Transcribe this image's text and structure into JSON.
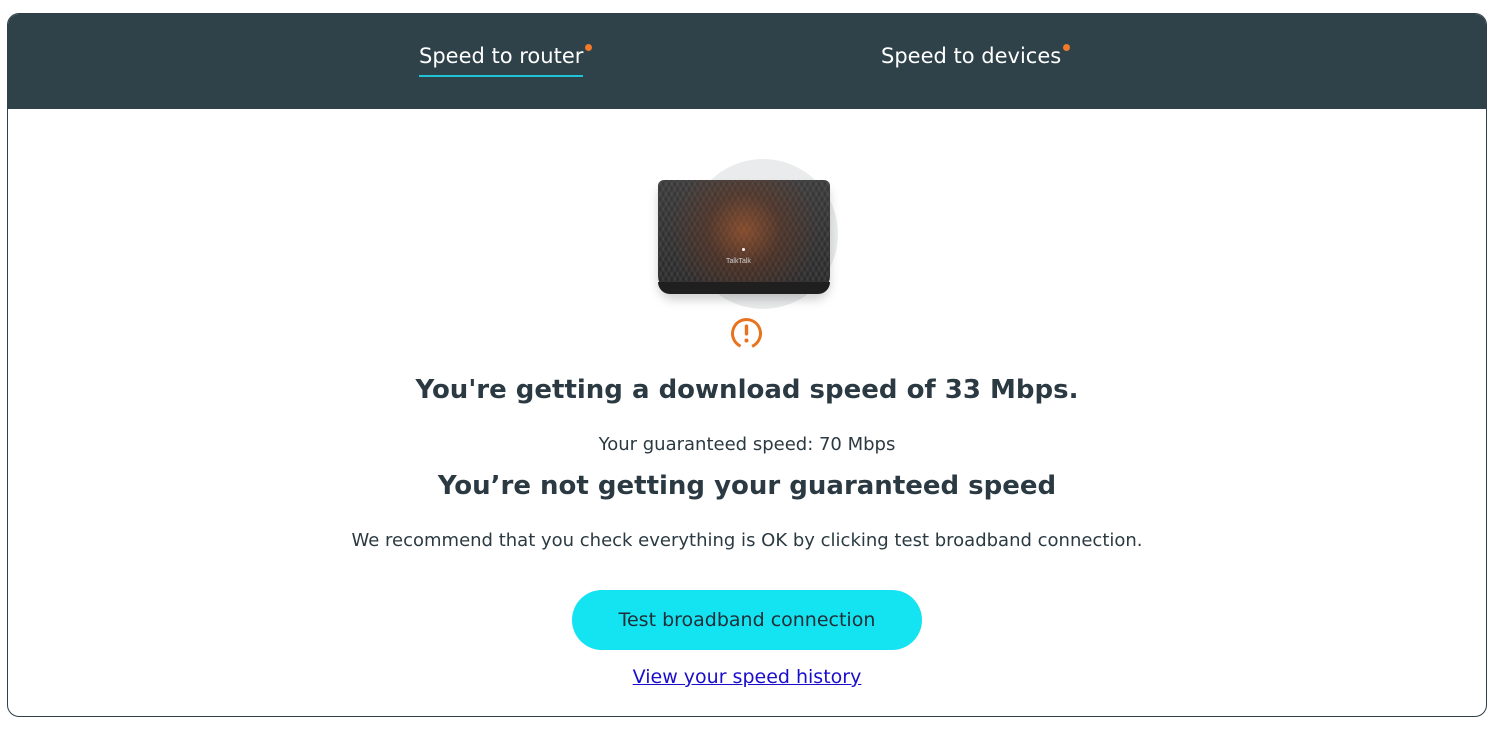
{
  "tabs": {
    "router_label": "Speed to router",
    "devices_label": "Speed to devices",
    "active": "router"
  },
  "router_image": {
    "logo_text": "TalkTalk"
  },
  "result": {
    "headline": "You're getting a download speed of 33 Mbps.",
    "guaranteed_speed": "Your guaranteed speed: 70 Mbps",
    "status": "You’re not getting your guaranteed speed",
    "recommendation": "We recommend that you check everything is OK by clicking test broadband connection."
  },
  "actions": {
    "test_button": "Test broadband connection",
    "history_link": "View your speed history"
  },
  "icons": {
    "warning": "warning-icon",
    "notification_dot": "notification-dot-icon"
  },
  "colors": {
    "header_bg": "#2f4149",
    "accent_cyan": "#14e3f2",
    "tab_underline": "#1fc4d6",
    "warning_orange": "#e8731f",
    "link_blue": "#1a0dcc"
  }
}
